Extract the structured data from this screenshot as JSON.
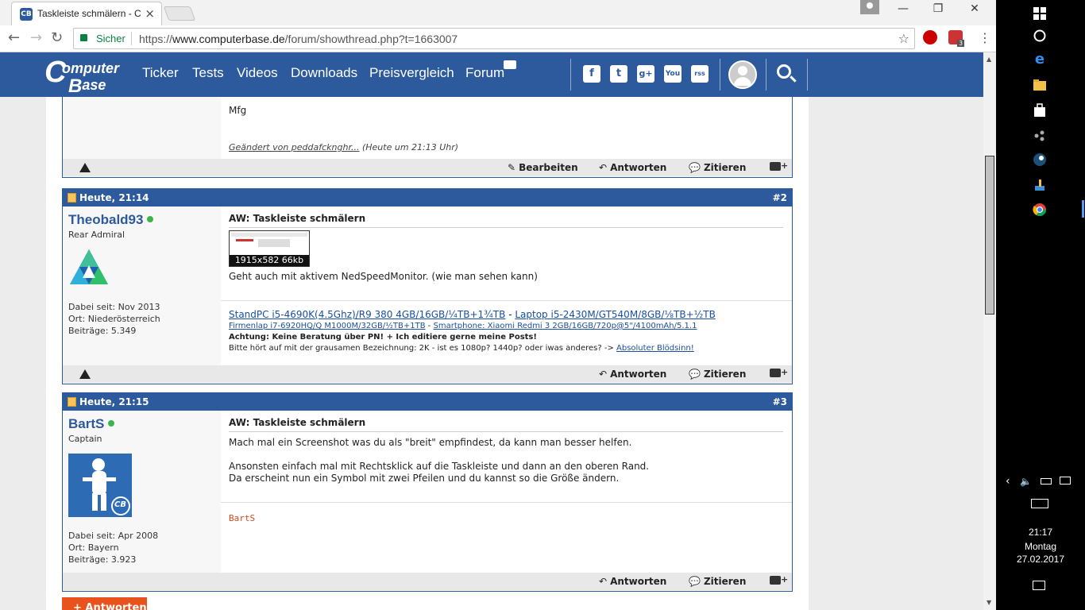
{
  "browser": {
    "tab_title": "Taskleiste schmälern - Co",
    "tab_favicon_text": "CB",
    "secure_label": "Sicher",
    "url_scheme": "https://",
    "url_host": "www.computerbase.de",
    "url_path": "/forum/showthread.php?t=1663007",
    "adblock_badge": "3"
  },
  "site": {
    "logo_top": "omputer",
    "logo_bottom": "ase",
    "logo_c": "C",
    "nav": [
      "Ticker",
      "Tests",
      "Videos",
      "Downloads",
      "Preisvergleich",
      "Forum"
    ],
    "social": [
      "f",
      "t",
      "g+",
      "You",
      "rss"
    ]
  },
  "post0": {
    "text": "Mfg",
    "edited_by": "Geändert von peddafcknghr...",
    "edited_time": " (Heute um 21:13 Uhr)",
    "btn_edit": "Bearbeiten",
    "btn_reply": "Antworten",
    "btn_quote": "Zitieren"
  },
  "post1": {
    "date": "Heute, 21:14",
    "num": "#2",
    "user": "Theobald93",
    "rank": "Rear Admiral",
    "joined": "Dabei seit: Nov 2013",
    "location": "Ort: Niederösterreich",
    "posts": "Beiträge: 5.349",
    "title": "AW: Taskleiste schmälern",
    "thumb_caption": "1915x582 66kb",
    "text": "Geht auch mit aktivem NedSpeedMonitor. (wie man sehen kann)",
    "sig1a": "StandPC i5-4690K(4.5Ghz)/R9 380 4GB/16GB/¼TB+1¾TB",
    "sig1sep": " - ",
    "sig1b": "Laptop i5-2430M/GT540M/8GB/⅛TB+½TB",
    "sig2a": "Firmenlap i7-6920HQ/Q M1000M/32GB/½TB+1TB",
    "sig2sep": " - ",
    "sig2b": "Smartphone: Xiaomi Redmi 3 2GB/16GB/720p@5\"/4100mAh/5.1.1",
    "sig3": "Achtung: Keine Beratung über PN! + Ich editiere gerne meine Posts!",
    "sig4": "Bitte hört auf mit der grausamen Bezeichnung: 2K - ist es 1080p? 1440p? oder iwas anderes? -> ",
    "sig4link": "Absoluter Blödsinn!",
    "btn_reply": "Antworten",
    "btn_quote": "Zitieren"
  },
  "post2": {
    "date": "Heute, 21:15",
    "num": "#3",
    "user": "BartS",
    "rank": "Captain",
    "joined": "Dabei seit: Apr 2008",
    "location": "Ort: Bayern",
    "posts": "Beiträge: 3.923",
    "title": "AW: Taskleiste schmälern",
    "text1": "Mach mal ein Screenshot was du als \"breit\" empfindest, da kann man besser helfen.",
    "text2": "Ansonsten einfach mal mit Rechtsklick auf die Taskleiste und dann an den oberen Rand.",
    "text3": "Da erscheint nun ein Symbol mit zwei Pfeilen und du kannst so die Größe ändern.",
    "signature": "BartS",
    "avatar_badge": "CB",
    "btn_reply": "Antworten",
    "btn_quote": "Zitieren"
  },
  "reply_button": "+ Antworten",
  "taskbar": {
    "time": "21:17",
    "day": "Montag",
    "date": "27.02.2017"
  },
  "colors": {
    "brand_blue": "#2d5a9c",
    "reply_orange": "#e8531d",
    "online_green": "#3cb44b"
  }
}
